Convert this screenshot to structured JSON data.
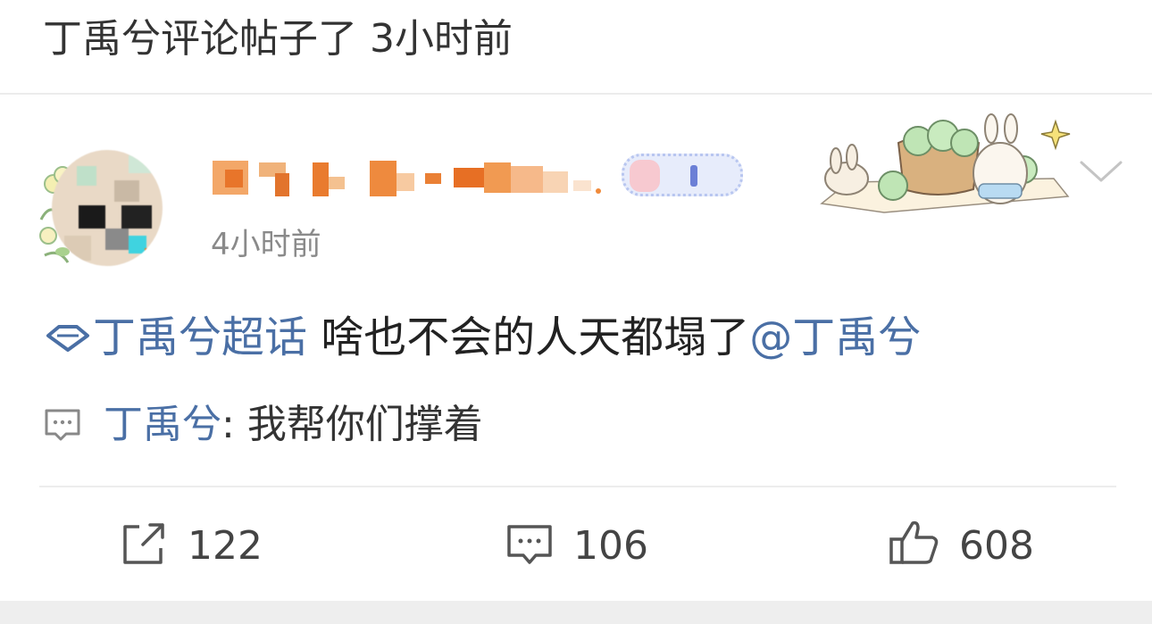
{
  "header": {
    "notification": "丁禹兮评论帖子了 3小时前"
  },
  "post": {
    "username": "",
    "time": "4小时前",
    "topic_label": "丁禹兮超话",
    "text": " 啥也不会的人天都塌了",
    "mention": "@丁禹兮"
  },
  "comment": {
    "commenter": "丁禹兮",
    "separator": ": ",
    "text": "我帮你们撑着"
  },
  "actions": {
    "repost_count": "122",
    "comment_count": "106",
    "like_count": "608"
  },
  "icons": {
    "topic": "diamond-topic-icon",
    "comment_preview": "comment-bubble-icon",
    "repost": "share-square-icon",
    "comment": "comment-bubble-icon",
    "like": "thumbs-up-icon",
    "more": "chevron-down-icon"
  },
  "colors": {
    "link": "#4a6fa5",
    "text": "#222222",
    "muted": "#8a8a8a"
  }
}
